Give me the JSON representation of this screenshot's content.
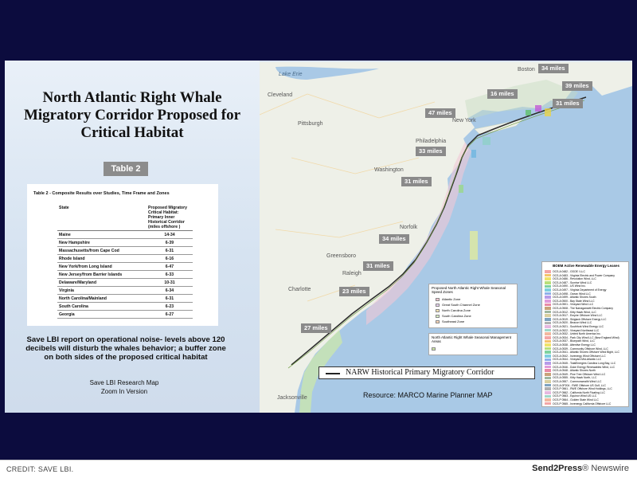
{
  "slide": {
    "title": "North Atlantic Right Whale Migratory Corridor Proposed for Critical Habitat",
    "table_badge": "Table 2",
    "table_caption": "Table 2 - Composite Results over Studies, Time Frame and Zones",
    "table_headers": [
      "State",
      "Proposed Migratory Critical Habitat: Primary Inner Historical Corridor (miles offshore )"
    ],
    "table_rows": [
      [
        "Maine",
        "14-34"
      ],
      [
        "New Hampshire",
        "6-39"
      ],
      [
        "Massachusetts/from Cape Cod",
        "6-31"
      ],
      [
        "Rhode Island",
        "6-16"
      ],
      [
        "New York/from Long Island",
        "6-47"
      ],
      [
        "New Jersey/from Barrier Islands",
        "6-33"
      ],
      [
        "Delaware/Maryland",
        "10-31"
      ],
      [
        "Virginia",
        "6-34"
      ],
      [
        "North Carolina/Mainland",
        "6-31"
      ],
      [
        "South Carolina",
        "6-23"
      ],
      [
        "Georgia",
        "6-27"
      ]
    ],
    "note": "Save LBI report on operational noise- levels above 120 decibels will disturb the whales behavior; a buffer zone on both sides of the proposed critical habitat",
    "map_credit_1": "Save LBI Research Map",
    "map_credit_2": "Zoom In Version"
  },
  "map": {
    "places": {
      "lake_erie": "Lake Erie",
      "boston": "Boston",
      "cleveland": "Cleveland",
      "pittsburgh": "Pittsburgh",
      "new_york": "New York",
      "philadelphia": "Philadelphia",
      "washington": "Washington",
      "norfolk": "Norfolk",
      "greensboro": "Greensboro",
      "raleigh": "Raleigh",
      "charlotte": "Charlotte",
      "jacksonville": "Jacksonville"
    },
    "distances": [
      "34 miles",
      "39 miles",
      "16 miles",
      "31 miles",
      "47 miles",
      "33 miles",
      "31 miles",
      "34 miles",
      "31 miles",
      "23 miles",
      "27 miles"
    ],
    "zone_legend_title": "Proposed North Atlantic Right Whale Seasonal Speed Zones",
    "zones": [
      "Atlantic Zone",
      "Great South Channel Zone",
      "North Carolina Zone",
      "South Carolina Zone",
      "Southeast Zone"
    ],
    "mgmt_legend_title": "North Atlantic Right Whale Seasonal Management Areas",
    "corridor_label": "NARW Historical Primary Migratory Corridor",
    "resource": "Resource: MARCO Marine Planner MAP",
    "boem_title": "BOEM Active Renewable Energy Leases",
    "boem_leases": [
      "OCS-A 0482 - GSOE I LLC",
      "OCS-A 0483 - Virginia Electric and Power Company",
      "OCS-A 0486 - Revolution Wind, LLC",
      "OCS-A 0487 - Sunrise Wind LLC",
      "OCS-A 0490 - US Wind Inc.",
      "OCS-A 0497 - Virginia Department of Energy",
      "OCS-A 0498 - Ocean Wind LLC",
      "OCS-A 0499 - Atlantic Shores South",
      "OCS-A 0500 - Bay State Wind LLC",
      "OCS-A 0501 - Vineyard Wind LLC",
      "OCS-A 0508 - The Narragansett Electric Company",
      "OCS-A 0512 - Kitty Hawk Wind, LLC",
      "OCS-A 0517 - Empire Offshore Wind LLC",
      "OCS-A 0519 - Skipjack Offshore Energy LLC",
      "OCS-A 0520 - Beacon Wind LLC",
      "OCS-A 0521 - Southfork Wind Energy LLC",
      "OCS-A 0522 - Vineyard Northeast LLC",
      "OCS-A 0532 - United North America Inc.",
      "OCS-A 0534 - Park City Wind LLC (New England Wind)",
      "OCS-A 0537 - Bluepoint Wind, LLC",
      "OCS-A 0538 - Attentive Energy LLC",
      "OCS-A 0539 - Community Offshore Wind, LLC",
      "OCS-A 0541 - Atlantic Shores Offshore Wind Bight, LLC",
      "OCS-A 0542 - Invenergy Wind Offshore LLC",
      "OCS-A 0544 - Vineyard Mid-Atlantic LLC",
      "OCS-A 0545 - TotalEnergies Carolina Long Bay, LLC",
      "OCS-A 0546 - Duke Energy Renewables Wind, LLC",
      "OCS-A 0548 - Atlantic Shores North",
      "OCS-A 0549 - Pine Tree Offshore Wind LLC",
      "OCS-A 0555 - Kitty Hawk North, LLC",
      "OCS-A 0557 - Commonwealth Wind LLC",
      "OCS-A 0P204 - RWE Offshore US Gulf, LLC",
      "OCS-P 0561 - RWE Offshore Wind Holdings, LLC",
      "OCS-P 0562 - California North Floating LLC",
      "OCS-P 0563 - Equinor Wind US LLC",
      "OCS-P 0564 - Golden State Wind LLC",
      "OCS-P 0565 - Invenergy California Offshore LLC"
    ]
  },
  "footer": {
    "credit": "CREDIT: SAVE LBI.",
    "brand_main": "Send2Press",
    "brand_rest": "® Newswire"
  },
  "colors": {
    "frame": "#0c0c3e",
    "ocean": "#9fc3e2",
    "land": "#eef0e8",
    "corridor_line": "#2b2b2b",
    "miles_badge": "#8a8a8a"
  }
}
